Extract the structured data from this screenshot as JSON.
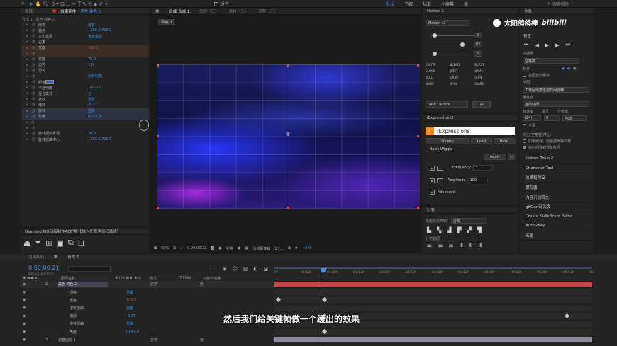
{
  "topbar": {
    "snap_label": "对齐",
    "workspaces": [
      "默认",
      "了解",
      "标准",
      "小屏幕",
      "库"
    ],
    "active_workspace": "默认",
    "search_placeholder": "搜索帮助"
  },
  "left_panel": {
    "tab_project": "项目",
    "tab_effects": "效果控件",
    "layer_name": "黑色 纯色 2",
    "breadcrumb": "合成 1 · 黑色 纯色 2",
    "rows": [
      {
        "label": "网格",
        "value": "重置"
      },
      {
        "label": "锚点",
        "value": "1280.0,720.0"
      },
      {
        "label": "大小依据",
        "value": "宽度滑块"
      },
      {
        "label": "边角",
        "value": ""
      },
      {
        "label": "宽度",
        "value": "100.0"
      },
      {
        "label": "",
        "value": ""
      },
      {
        "label": "高度",
        "value": "70.0"
      },
      {
        "label": "边界",
        "value": "1.0"
      },
      {
        "label": "羽化",
        "value": ""
      },
      {
        "label": "",
        "value": "反转网格"
      },
      {
        "label": "颜色",
        "value": ""
      },
      {
        "label": "不透明度",
        "value": "100.0%"
      },
      {
        "label": "混合模式",
        "value": "无"
      },
      {
        "label": "波纹",
        "value": "重置"
      },
      {
        "label": "缩放",
        "value": "-6.37"
      },
      {
        "label": "旋转",
        "value": "重置"
      },
      {
        "label": "角度",
        "value": "0x+0.0°"
      },
      {
        "label": "",
        "value": ""
      },
      {
        "label": "",
        "value": ""
      },
      {
        "label": "旋转扭曲半径",
        "value": "30.0"
      },
      {
        "label": "旋转扭曲中心",
        "value": "1280.0,720.0"
      }
    ]
  },
  "overlord": {
    "title": "Overlord MG动画制作AE扩展【输入任意注册码激活】"
  },
  "composition": {
    "tab": "合成 合成 1",
    "layer_tab": "图层（无）",
    "footage_tab": "素材（无）",
    "flow_tab": "流程（无）",
    "comp_label": "合成 1",
    "zoom": "50%",
    "timecode": "0:00:00:21",
    "quality": "完整",
    "camera": "活动摄像机",
    "views": "1个...",
    "exposure": "+0.0"
  },
  "motion2": {
    "title": "Motion 2",
    "version": "Motion v2",
    "slider_values": [
      "0",
      "82",
      "0"
    ],
    "buttons": [
      "EXCITE",
      "BLEND",
      "BURST",
      "CLONE",
      "JUMP",
      "NAME",
      "NULL",
      "ORBIT",
      "ROPE",
      "WARP",
      "SPIN",
      "STARE"
    ],
    "task": "Task Launch"
  },
  "iexpressions": {
    "panel_title": "iExpressions2",
    "logo_text": "iExpressions",
    "tabs": [
      "Library",
      "Load",
      "Bake"
    ],
    "preset": "Basic Wiggle",
    "apply": "Apply",
    "frequency_label": "Frequency",
    "frequency_value": "3",
    "amplitude_label": "Amplitude",
    "amplitude_value": "100",
    "advanced": "Advanced"
  },
  "align": {
    "title": "对齐",
    "align_to_label": "将图层对齐到:",
    "align_to_value": "合成",
    "distribute": "分布图层:"
  },
  "right_panel": {
    "info": "信息",
    "brand": "太阳鸽鸽棒",
    "preview": "预览",
    "shortcut_label": "快捷键",
    "shortcut_value": "空格键",
    "include_label": "包含:",
    "cache_check": "在回放前缓存",
    "range_label": "范围",
    "range_value": "工作区域按当前时间延伸",
    "play_from_label": "播放自",
    "play_from_value": "当前时间",
    "fps_label": "帧速率",
    "skip_label": "跳过",
    "res_label": "分辨率",
    "fps_value": "(24)",
    "skip_value": "0",
    "res_value": "自动",
    "fullscreen": "全屏",
    "stop_label": "点击(空格键)停止:",
    "cache_opt": "如果缓存，则播放缓存的帧",
    "move_time": "将时间移到预览时间",
    "items": [
      "Motion Tools 2",
      "Character Tool",
      "效果和预设",
      "跟踪器",
      "内容识别填充",
      "gifGun汉化版",
      "Create Nulls From Paths",
      "AutoSway",
      "画笔"
    ]
  },
  "timeline": {
    "tab_render": "渲染队列",
    "tab_comp": "合成 1",
    "timecode": "0:00:00:21",
    "frame_info": "00021 (24.00 fps)",
    "col_layer": "图层名称",
    "col_mode": "模式",
    "col_trkmat": "TrkMat",
    "col_parent": "父级和链接",
    "ruler": [
      "0f",
      "00:12f",
      "01:00f",
      "01:12f",
      "02:00f",
      "02:12f",
      "03:00f",
      "03:12f",
      "04:00f",
      "04:12f",
      "05:00f",
      "05:12f",
      "06"
    ],
    "rows": [
      {
        "num": "2",
        "name": "黑色 纯色 2",
        "mode": "正常",
        "parent": "无"
      },
      {
        "num": "",
        "name": "网格",
        "value": "重置"
      },
      {
        "num": "",
        "name": "宽度",
        "value": "100.0"
      },
      {
        "num": "",
        "name": "波纹扭曲",
        "value": "重置"
      },
      {
        "num": "",
        "name": "缩放",
        "value": "-6.37"
      },
      {
        "num": "",
        "name": "旋转扭曲",
        "value": "重置"
      },
      {
        "num": "",
        "name": "角度",
        "value": "0x+0.0°"
      },
      {
        "num": "3",
        "name": "调整图层 1",
        "mode": "正常",
        "parent": "无"
      }
    ]
  },
  "subtitle": "然后我们给关键帧做一个缓出的效果"
}
